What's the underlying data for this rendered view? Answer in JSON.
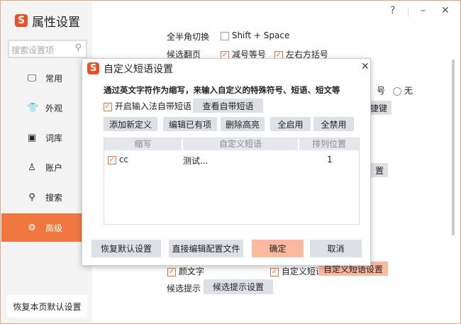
{
  "window": {
    "title": "属性设置",
    "search_placeholder": "搜索设置项",
    "help": "?",
    "minimize": "–",
    "close": "✕",
    "reset_page": "恢复本页默认设置"
  },
  "sidebar": {
    "items": [
      {
        "label": "常用",
        "icon": "monitor-icon"
      },
      {
        "label": "外观",
        "icon": "shirt-icon"
      },
      {
        "label": "词库",
        "icon": "book-icon"
      },
      {
        "label": "账户",
        "icon": "user-icon"
      },
      {
        "label": "搜索",
        "icon": "search-icon"
      },
      {
        "label": "高级",
        "icon": "gear-icon",
        "active": true
      }
    ]
  },
  "background": {
    "fullhalf_label": "全半角切换",
    "fullhalf_option": "Shift + Space",
    "page_label": "候选翻页",
    "page_opt1": "减号等号",
    "page_opt2": "左右方括号",
    "radio_partial": "号",
    "radio_none": "无",
    "btn_partial1": "捷键",
    "btn_partial2": "置",
    "emoticon": "颜文字",
    "custom_phrase": "自定义短语",
    "custom_phrase_settings": "自定义短语设置",
    "hint_label": "候选提示",
    "hint_settings": "候选提示设置"
  },
  "dialog": {
    "title": "自定义短语设置",
    "close": "✕",
    "description": "通过英文字符作为缩写，来输入自定义的特殊符号、短语、短文等",
    "enable_builtin": "开启输入法自带短语",
    "view_builtin": "查看自带短语",
    "add": "添加新定义",
    "edit": "编辑已有项",
    "delete": "删除高亮",
    "enable_all": "全启用",
    "disable_all": "全禁用",
    "columns": [
      "缩写",
      "自定义短语",
      "排列位置"
    ],
    "rows": [
      {
        "abbr": "cc",
        "phrase": "测试...",
        "position": "1",
        "checked": true
      }
    ],
    "restore_default": "恢复默认设置",
    "edit_config": "直接编辑配置文件",
    "ok": "确定",
    "cancel": "取消"
  },
  "colors": {
    "accent": "#f07840",
    "confirm": "#fbb9a0"
  }
}
